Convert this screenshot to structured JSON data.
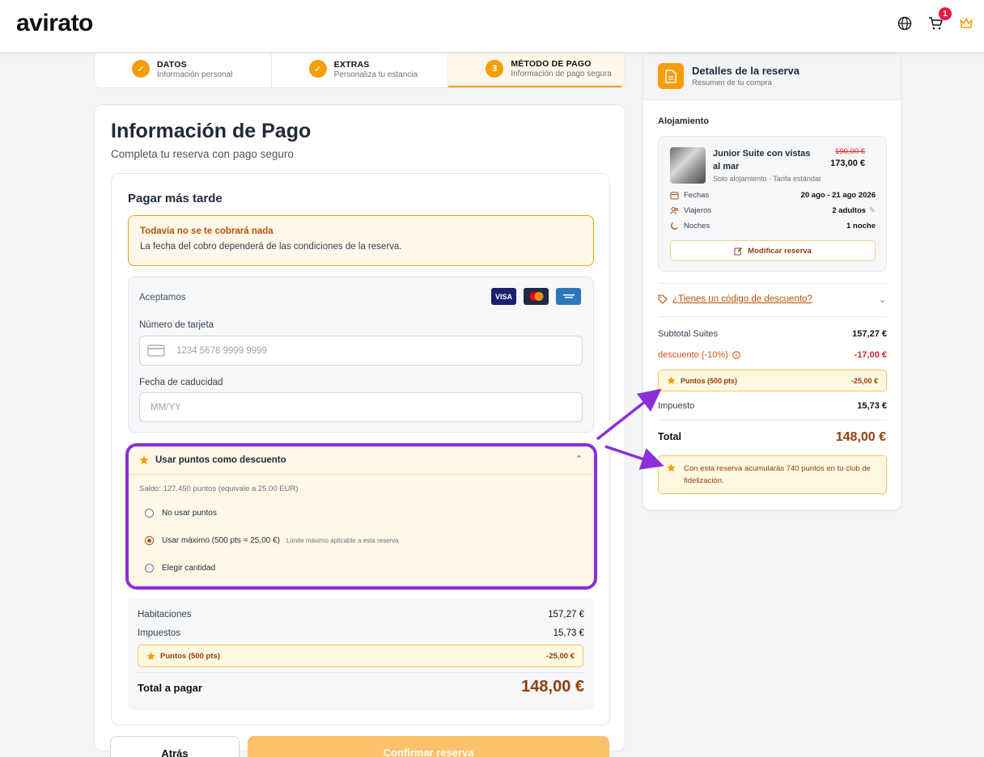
{
  "header": {
    "logo": "avirato",
    "cart_count": "1"
  },
  "stepper": [
    {
      "marker": "✓",
      "title": "DATOS",
      "subtitle": "Información personal"
    },
    {
      "marker": "✓",
      "title": "EXTRAS",
      "subtitle": "Personaliza tu estancia"
    },
    {
      "marker": "3",
      "title": "MÉTODO DE PAGO",
      "subtitle": "Información de pago segura"
    }
  ],
  "payment": {
    "title": "Información de Pago",
    "subtitle": "Completa tu reserva con pago seguro",
    "section_title": "Pagar más tarde",
    "notice_title": "Todavía no se te cobrará nada",
    "notice_text": "La fecha del cobro dependerá de las condiciones de la reserva.",
    "accept_label": "Aceptamos",
    "card_brands": [
      "VISA",
      "Mastercard",
      "Amex"
    ],
    "card_number_label": "Número de tarjeta",
    "card_number_placeholder": "1234 5678 9999 9999",
    "expiry_label": "Fecha de caducidad",
    "expiry_placeholder": "MM/YY"
  },
  "points": {
    "title": "Usar puntos como descuento",
    "balance": "Saldo: 127.450 puntos (equivale a 25.00 EUR)",
    "options": [
      {
        "label": "No usar puntos",
        "selected": false,
        "hint": ""
      },
      {
        "label": "Usar máximo (500 pts = 25,00 €)",
        "selected": true,
        "hint": "Límite máximo aplicable a esta reserva"
      },
      {
        "label": "Elegir cantidad",
        "selected": false,
        "hint": ""
      }
    ]
  },
  "summary": {
    "rooms_label": "Habitaciones",
    "rooms_value": "157,27 €",
    "taxes_label": "Impuestos",
    "taxes_value": "15,73 €",
    "points_label": "Puntos (500 pts)",
    "points_value": "-25,00 €",
    "total_label": "Total a pagar",
    "total_value": "148,00 €"
  },
  "buttons": {
    "back": "Atrás",
    "confirm": "Confirmar reserva"
  },
  "booking": {
    "title": "Detalles de la reserva",
    "subtitle": "Resumen de tu compra",
    "section": "Alojamiento",
    "room_name": "Junior Suite con vistas al mar",
    "old_price": "190,00 €",
    "new_price": "173,00 €",
    "room_meta": "Solo alojamiento · Tarifa estándar",
    "dates_label": "Fechas",
    "dates_value": "20 ago - 21 ago 2026",
    "travelers_label": "Viajeros",
    "travelers_value": "2 adultos",
    "nights_label": "Noches",
    "nights_value": "1 noche",
    "modify_label": "Modificar reserva",
    "discount_link": "¿Tienes un código de descuento?",
    "subtotal_label": "Subtotal Suites",
    "subtotal_value": "157,27 €",
    "discount_label": "descuento (-10%)",
    "discount_value": "-17,00 €",
    "points_label": "Puntos (500 pts)",
    "points_value": "-25,00 €",
    "tax_label": "Impuesto",
    "tax_value": "15,73 €",
    "total_label": "Total",
    "total_value": "148,00 €",
    "earn_text": "Con esta reserva acumularás 740 puntos en tu club de fidelización."
  },
  "colors": {
    "accent": "#f59e0b",
    "highlight": "#8b2fd9",
    "brown": "#92400e"
  }
}
